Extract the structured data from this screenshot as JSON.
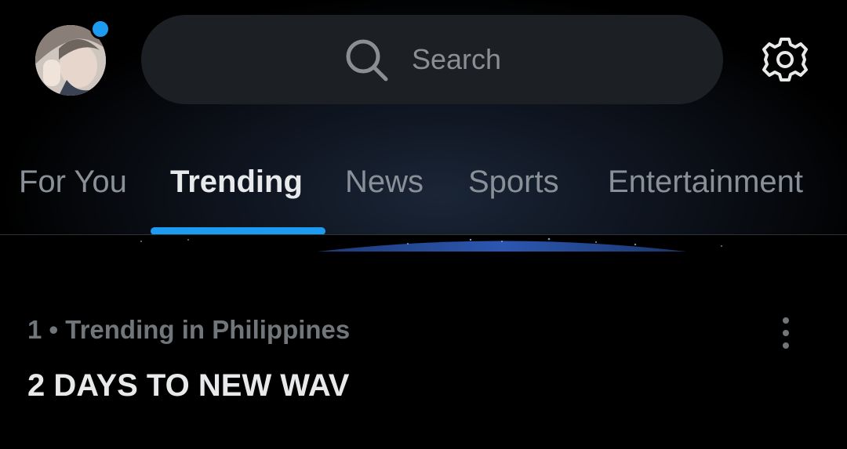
{
  "header": {
    "avatar_alt": "profile",
    "search": {
      "placeholder": "Search"
    },
    "icons": {
      "search": "search-icon",
      "settings": "gear-icon",
      "notification": "blue-dot"
    }
  },
  "tabs": [
    {
      "label": "For You",
      "active": false
    },
    {
      "label": "Trending",
      "active": true
    },
    {
      "label": "News",
      "active": false
    },
    {
      "label": "Sports",
      "active": false
    },
    {
      "label": "Entertainment",
      "active": false
    }
  ],
  "trend": {
    "context": "1 • Trending in Philippines",
    "title": "2 DAYS TO NEW WAV",
    "more_icon": "more-vertical-icon"
  },
  "colors": {
    "accent": "#1d9bf0",
    "background": "#000000",
    "search_bg": "#1c1f24",
    "text_primary": "#e7e9ea",
    "text_secondary": "#71767b"
  }
}
